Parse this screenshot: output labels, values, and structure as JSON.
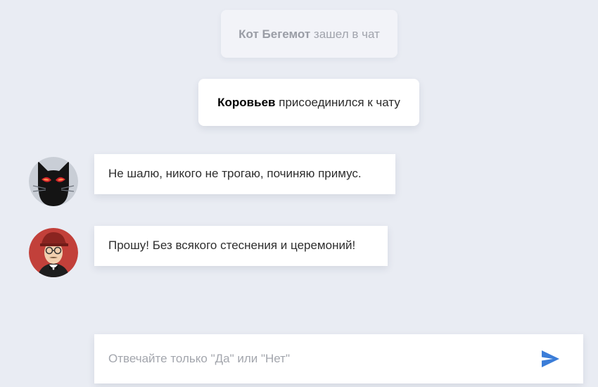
{
  "chat": {
    "system_notes": [
      {
        "nick": "Кот Бегемот",
        "action": "зашел в чат"
      },
      {
        "nick": "Коровьев",
        "action": "присоединился к чату"
      }
    ],
    "messages": [
      {
        "author_icon": "black-cat-avatar",
        "text": "Не шалю, никого не трогаю, починяю примус."
      },
      {
        "author_icon": "man-glasses-cap-avatar",
        "text": "Прошу! Без всякого стеснения и церемоний!"
      }
    ]
  },
  "composer": {
    "placeholder": "Отвечайте только \"Да\" или \"Нет\"",
    "send_icon": "paper-plane-icon"
  },
  "colors": {
    "background": "#e9ecf3",
    "send_accent": "#3b7dd8",
    "avatar_red": "#c2403a"
  }
}
